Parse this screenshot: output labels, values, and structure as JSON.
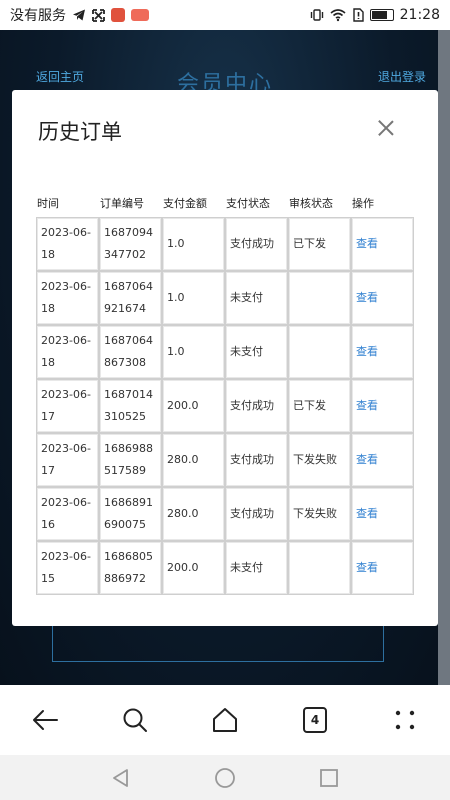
{
  "status_bar": {
    "carrier": "没有服务",
    "time": "21:28"
  },
  "background": {
    "back_home": "返回主页",
    "page_title": "会员中心",
    "logout": "退出登录"
  },
  "modal": {
    "title": "历史订单",
    "columns": [
      "时间",
      "订单编号",
      "支付金额",
      "支付状态",
      "审核状态",
      "操作"
    ],
    "rows": [
      {
        "time": "2023-06-18",
        "order_no": "1687094347702",
        "amount": "1.0",
        "pay_status": "支付成功",
        "audit_status": "已下发",
        "action": "查看"
      },
      {
        "time": "2023-06-18",
        "order_no": "1687064921674",
        "amount": "1.0",
        "pay_status": "未支付",
        "audit_status": "",
        "action": "查看"
      },
      {
        "time": "2023-06-18",
        "order_no": "1687064867308",
        "amount": "1.0",
        "pay_status": "未支付",
        "audit_status": "",
        "action": "查看"
      },
      {
        "time": "2023-06-17",
        "order_no": "1687014310525",
        "amount": "200.0",
        "pay_status": "支付成功",
        "audit_status": "已下发",
        "action": "查看"
      },
      {
        "time": "2023-06-17",
        "order_no": "1686988517589",
        "amount": "280.0",
        "pay_status": "支付成功",
        "audit_status": "下发失败",
        "action": "查看"
      },
      {
        "time": "2023-06-16",
        "order_no": "1686891690075",
        "amount": "280.0",
        "pay_status": "支付成功",
        "audit_status": "下发失败",
        "action": "查看"
      },
      {
        "time": "2023-06-15",
        "order_no": "1686805886972",
        "amount": "200.0",
        "pay_status": "未支付",
        "audit_status": "",
        "action": "查看"
      }
    ]
  },
  "browser_bar": {
    "tab_count": "4"
  },
  "colors": {
    "link": "#2f7fd0",
    "page_bg": "#0b1624"
  }
}
